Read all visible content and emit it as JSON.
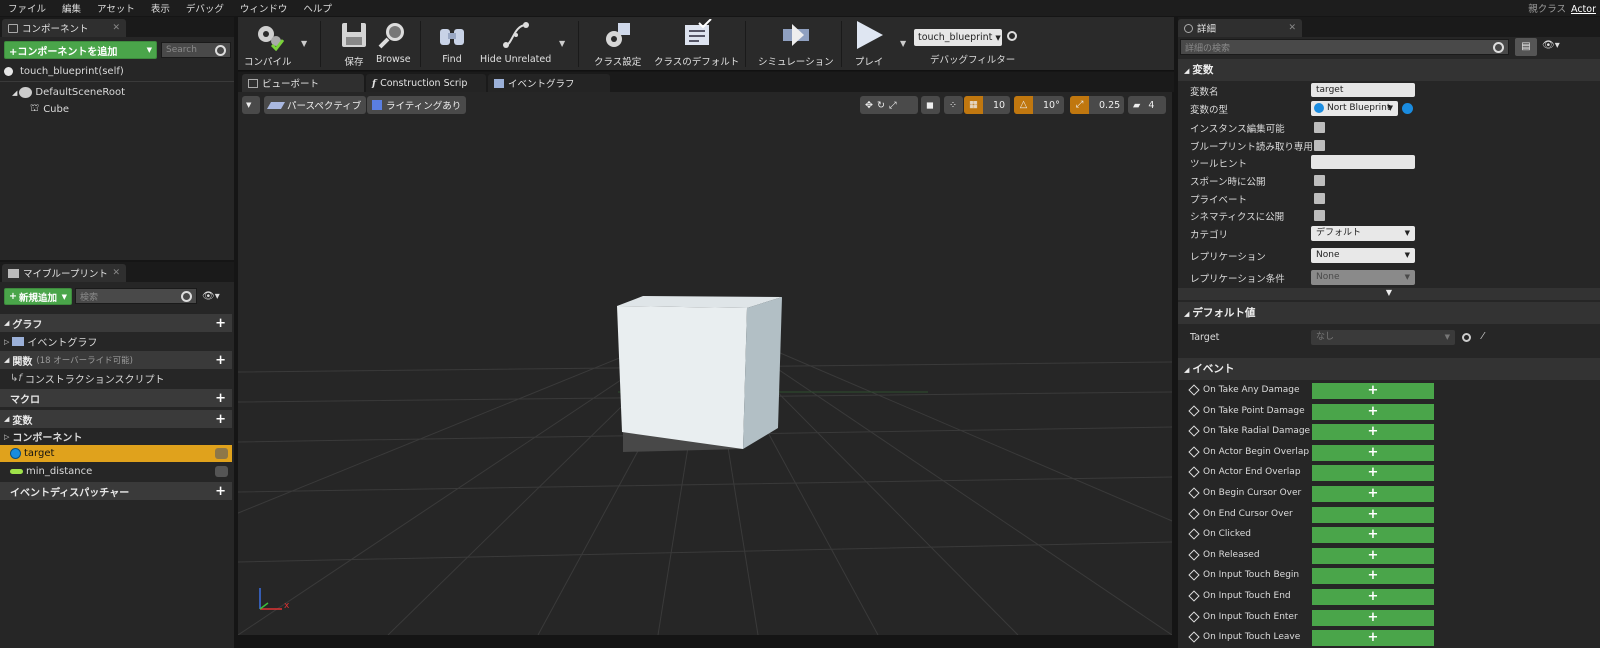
{
  "menu": [
    "ファイル",
    "編集",
    "アセット",
    "表示",
    "デバッグ",
    "ウィンドウ",
    "ヘルプ"
  ],
  "parent_class": {
    "label": "親クラス",
    "value": "Actor"
  },
  "components_panel": {
    "tab": "コンポーネント",
    "add_button": "+コンポーネントを追加",
    "search_placeholder": "Search",
    "self_item": "touch_blueprint(self)",
    "tree": [
      {
        "label": "DefaultSceneRoot"
      },
      {
        "label": "Cube"
      }
    ]
  },
  "my_blueprint": {
    "tab": "マイブループリント",
    "add_button": "新規追加",
    "search_placeholder": "検索",
    "sections": {
      "graph": "グラフ",
      "event_graph": "イベントグラフ",
      "functions": "関数",
      "functions_note": "(18 オーバーライド可能)",
      "construction_script": "コンストラクションスクリプト",
      "macros": "マクロ",
      "variables": "変数",
      "components": "コンポーネント",
      "var_target": "target",
      "var_min_distance": "min_distance",
      "dispatchers": "イベントディスパッチャー"
    }
  },
  "toolbar": {
    "compile": "コンパイル",
    "save": "保存",
    "browse": "Browse",
    "find": "Find",
    "hide_unrelated": "Hide Unrelated",
    "class_settings": "クラス設定",
    "class_defaults": "クラスのデフォルト",
    "simulation": "シミュレーション",
    "play": "プレイ",
    "debug_object": "touch_blueprint",
    "debug_filter": "デバッグフィルター"
  },
  "editor_tabs": {
    "viewport": "ビューポート",
    "construction": "Construction Scrip",
    "event_graph": "イベントグラフ"
  },
  "viewport": {
    "perspective": "パースペクティブ",
    "lighting": "ライティングあり",
    "grid_snap": "10",
    "rot_snap": "10°",
    "scale_snap": "0.25",
    "cam_speed": "4",
    "axis_x": "x"
  },
  "details": {
    "tab": "詳細",
    "search_placeholder": "詳細の検索",
    "variable_section": "変数",
    "var_name_label": "変数名",
    "var_name_value": "target",
    "var_type_label": "変数の型",
    "var_type_value": "Nort Blueprint",
    "instance_editable": "インスタンス編集可能",
    "bp_readonly": "ブループリント読み取り専用",
    "tooltip": "ツールヒント",
    "expose_spawn": "スポーン時に公開",
    "private": "プライベート",
    "expose_cinematics": "シネマティクスに公開",
    "category_label": "カテゴリ",
    "category_value": "デフォルト",
    "replication_label": "レプリケーション",
    "replication_value": "None",
    "replication_cond_label": "レプリケーション条件",
    "replication_cond_value": "None",
    "default_section": "デフォルト値",
    "target_label": "Target",
    "target_value": "なし",
    "events_section": "イベント",
    "events": [
      "On Take Any Damage",
      "On Take Point Damage",
      "On Take Radial Damage",
      "On Actor Begin Overlap",
      "On Actor End Overlap",
      "On Begin Cursor Over",
      "On End Cursor Over",
      "On Clicked",
      "On Released",
      "On Input Touch Begin",
      "On Input Touch End",
      "On Input Touch Enter",
      "On Input Touch Leave"
    ],
    "event_button": "+"
  },
  "colors": {
    "accent_green": "#4aa54a",
    "selected_row": "#e0a21c",
    "orange_toggle": "#c0770f"
  }
}
